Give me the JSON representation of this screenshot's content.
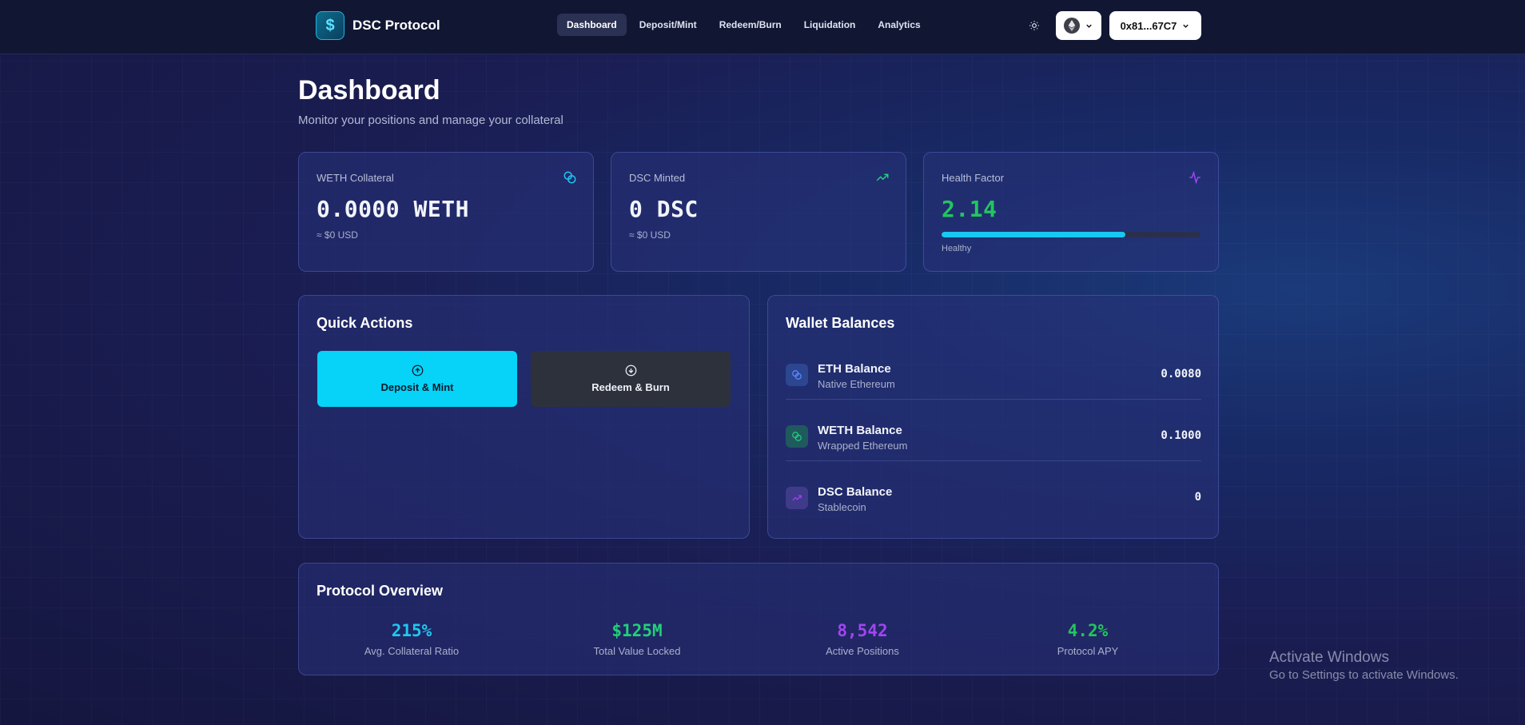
{
  "app": {
    "name": "DSC Protocol",
    "logo_glyph": "$"
  },
  "nav": {
    "items": [
      {
        "label": "Dashboard",
        "active": true
      },
      {
        "label": "Deposit/Mint",
        "active": false
      },
      {
        "label": "Redeem/Burn",
        "active": false
      },
      {
        "label": "Liquidation",
        "active": false
      },
      {
        "label": "Analytics",
        "active": false
      }
    ],
    "address": "0x81...67C7"
  },
  "page": {
    "title": "Dashboard",
    "subtitle": "Monitor your positions and manage your collateral"
  },
  "stats": {
    "weth": {
      "label": "WETH Collateral",
      "value": "0.0000 WETH",
      "sub": "≈ $0 USD"
    },
    "dsc": {
      "label": "DSC Minted",
      "value": "0 DSC",
      "sub": "≈ $0 USD"
    },
    "health": {
      "label": "Health Factor",
      "value": "2.14",
      "status": "Healthy",
      "bar_fraction": 0.71
    }
  },
  "quick_actions": {
    "title": "Quick Actions",
    "deposit_label": "Deposit & Mint",
    "redeem_label": "Redeem & Burn"
  },
  "wallet": {
    "title": "Wallet Balances",
    "rows": [
      {
        "name": "ETH Balance",
        "desc": "Native Ethereum",
        "value": "0.0080"
      },
      {
        "name": "WETH Balance",
        "desc": "Wrapped Ethereum",
        "value": "0.1000"
      },
      {
        "name": "DSC Balance",
        "desc": "Stablecoin",
        "value": "0"
      }
    ]
  },
  "overview": {
    "title": "Protocol Overview",
    "items": [
      {
        "value": "215%",
        "label": "Avg. Collateral Ratio",
        "color": "#1fc8f0"
      },
      {
        "value": "$125M",
        "label": "Total Value Locked",
        "color": "#22d07a"
      },
      {
        "value": "8,542",
        "label": "Active Positions",
        "color": "#a046f0"
      },
      {
        "value": "4.2%",
        "label": "Protocol APY",
        "color": "#22c55e"
      }
    ]
  },
  "colors": {
    "accent_cyan": "#06d3f7",
    "accent_green": "#22c55e",
    "accent_purple": "#a046f0"
  },
  "watermark": {
    "line1": "Activate Windows",
    "line2": "Go to Settings to activate Windows."
  }
}
